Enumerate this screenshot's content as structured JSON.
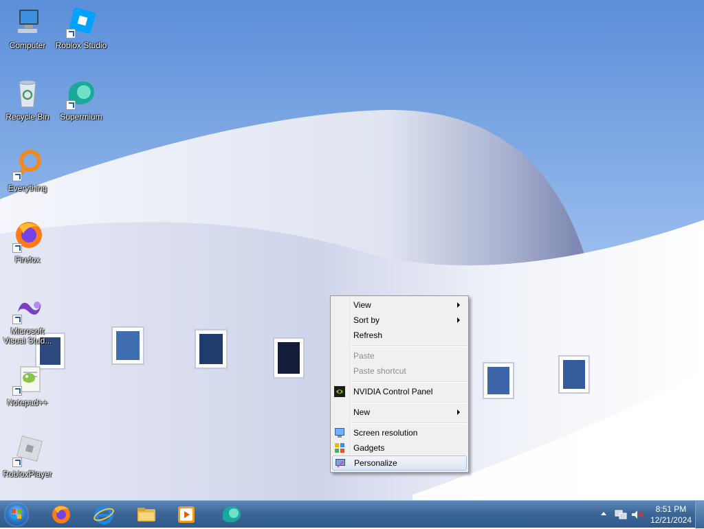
{
  "desktop": {
    "icons": [
      {
        "label": "Computer",
        "icon": "computer-icon"
      },
      {
        "label": "Roblox Studio",
        "icon": "roblox-studio-icon"
      },
      {
        "label": "Recycle Bin",
        "icon": "recycle-bin-icon"
      },
      {
        "label": "Supermium",
        "icon": "supermium-icon"
      },
      {
        "label": "Everything",
        "icon": "everything-icon"
      },
      {
        "label": "Firefox",
        "icon": "firefox-icon"
      },
      {
        "label": "Microsoft Visual Stud...",
        "icon": "visual-studio-icon"
      },
      {
        "label": "Notepad++",
        "icon": "notepadpp-icon"
      },
      {
        "label": "RobloxPlayer",
        "icon": "roblox-player-icon"
      }
    ]
  },
  "context_menu": {
    "items": [
      {
        "label": "View",
        "submenu": true
      },
      {
        "label": "Sort by",
        "submenu": true
      },
      {
        "label": "Refresh"
      },
      {
        "label": "Paste",
        "disabled": true
      },
      {
        "label": "Paste shortcut",
        "disabled": true
      },
      {
        "label": "NVIDIA Control Panel",
        "icon": "nvidia-icon"
      },
      {
        "label": "New",
        "submenu": true
      },
      {
        "label": "Screen resolution",
        "icon": "screen-resolution-icon"
      },
      {
        "label": "Gadgets",
        "icon": "gadgets-icon"
      },
      {
        "label": "Personalize",
        "icon": "personalize-icon",
        "highlighted": true
      }
    ]
  },
  "taskbar": {
    "start_icon": "windows-start-icon",
    "pinned": [
      "firefox-icon",
      "internet-explorer-icon",
      "file-explorer-icon",
      "media-player-icon",
      "supermium-icon"
    ],
    "tray_icons": [
      "show-hidden-icons-arrow",
      "network-icon",
      "volume-muted-icon"
    ],
    "clock": {
      "time": "8:51 PM",
      "date": "12/21/2024"
    }
  },
  "colors": {
    "sky": "#8fb4e8",
    "taskbar": "#3d6797",
    "menu_bg": "#f0f0f0",
    "menu_highlight": "#dbe6f4"
  }
}
